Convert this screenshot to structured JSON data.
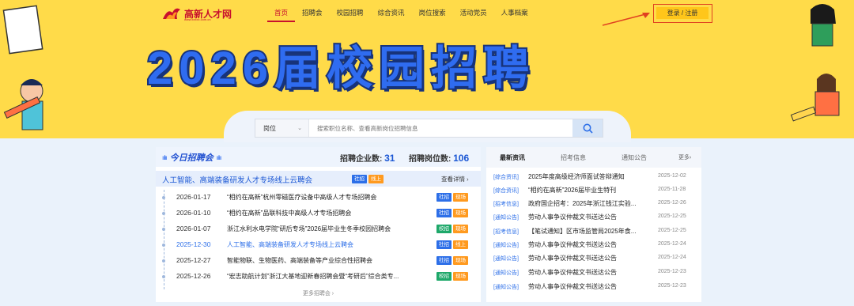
{
  "brand": {
    "name": "高新人才网",
    "sub": "www.xxxxx.com.cn"
  },
  "nav": [
    {
      "label": "首页",
      "active": true
    },
    {
      "label": "招聘会"
    },
    {
      "label": "校园招聘"
    },
    {
      "label": "综合资讯"
    },
    {
      "label": "岗位搜索"
    },
    {
      "label": "活动党员"
    },
    {
      "label": "人事档案"
    }
  ],
  "login": {
    "label": "登录 / 注册"
  },
  "banner": {
    "title_chars": [
      "2",
      "0",
      "2",
      "6",
      "届",
      "校",
      "园",
      "招",
      "聘"
    ]
  },
  "search": {
    "category": "岗位",
    "placeholder": "搜索职位名称、查看高新岗位招聘信息"
  },
  "fairs": {
    "header_title": "今日招聘会",
    "company_label": "招聘企业数:",
    "company_count": "31",
    "job_label": "招聘岗位数:",
    "job_count": "106",
    "feature": {
      "title": "人工智能、高端装备研发人才专场线上云聘会",
      "tags": [
        "社招",
        "线上"
      ],
      "more": "查看详情"
    },
    "rows": [
      {
        "date": "2026-01-17",
        "title": "“相约在高新”杭州零磁医疗设备中高级人才专场招聘会",
        "tags": [
          "社招",
          "现场"
        ]
      },
      {
        "date": "2026-01-10",
        "title": "“相约在高新”品联科技中高级人才专场招聘会",
        "tags": [
          "社招",
          "现场"
        ]
      },
      {
        "date": "2026-01-07",
        "title": "浙江水利水电学院“研后专场”2026届毕业生冬季校园招聘会",
        "tags": [
          "校招",
          "现场"
        ]
      },
      {
        "date": "2025-12-30",
        "title": "人工智能、高端装备研发人才专场线上云聘会",
        "tags": [
          "社招",
          "线上"
        ],
        "highlight": true
      },
      {
        "date": "2025-12-27",
        "title": "智能物联、生物医药、高端装备等产业综合性招聘会",
        "tags": [
          "社招",
          "现场"
        ]
      },
      {
        "date": "2025-12-26",
        "title": "“宏志助航计划”浙江大基地迎新春招聘会暨“考研后”综合类专...",
        "tags": [
          "校招",
          "现场"
        ]
      }
    ],
    "more_label": "更多招聘会"
  },
  "news": {
    "tabs": [
      "最新资讯",
      "招考信息",
      "通知公告"
    ],
    "more": "更多",
    "items": [
      {
        "cat": "[综合资讯]",
        "title": "2025年度高级经济师面试答辩通知",
        "date": "2025-12-02"
      },
      {
        "cat": "[综合资讯]",
        "title": "“相约在高新”2026届毕业生特刊",
        "date": "2025-11-28"
      },
      {
        "cat": "[招考信息]",
        "title": "政府国企招考：2025年浙江钱江实验...",
        "date": "2025-12-26"
      },
      {
        "cat": "[通知公告]",
        "title": "劳动人事争议仲裁文书送达公告",
        "date": "2025-12-25"
      },
      {
        "cat": "[招考信息]",
        "title": "【笔试通知】区市场监管局2025年食...",
        "date": "2025-12-25"
      },
      {
        "cat": "[通知公告]",
        "title": "劳动人事争议仲裁文书送达公告",
        "date": "2025-12-24"
      },
      {
        "cat": "[通知公告]",
        "title": "劳动人事争议仲裁文书送达公告",
        "date": "2025-12-24"
      },
      {
        "cat": "[通知公告]",
        "title": "劳动人事争议仲裁文书送达公告",
        "date": "2025-12-23"
      },
      {
        "cat": "[通知公告]",
        "title": "劳动人事争议仲裁文书送达公告",
        "date": "2025-12-23"
      }
    ]
  },
  "colors": {
    "brand_red": "#c8102e",
    "accent_blue": "#2d6fe8",
    "hero_yellow": "#ffdb49"
  }
}
